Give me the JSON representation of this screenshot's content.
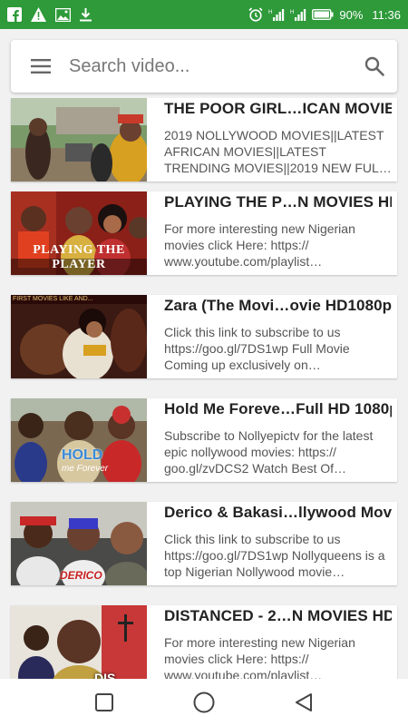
{
  "status_bar": {
    "battery": "90%",
    "time": "11:36",
    "left_icons": [
      "facebook-icon",
      "warning-icon",
      "image-icon",
      "download-icon"
    ],
    "right_icons": [
      "alarm-icon",
      "signal-icon",
      "signal-icon",
      "battery-icon"
    ]
  },
  "search": {
    "placeholder": "Search video..."
  },
  "videos": [
    {
      "title": "THE POOR GIRL…ICAN MOVIES",
      "description": "2019 NOLLYWOOD MOVIES||LATEST AFRICAN MOVIES||LATEST TRENDING MOVIES||2019 NEW FUL…"
    },
    {
      "title": "PLAYING THE P…N MOVIES HD",
      "description": "For more interesting new Nigerian movies click Here: https:// www.youtube.com/playlist…",
      "thumb_caption": "PLAYING THE PLAYER"
    },
    {
      "title": "Zara (The Movi…ovie HD1080p",
      "description": "Click this link to subscribe to us https://goo.gl/7DS1wp Full Movie Coming up exclusively on…",
      "thumb_caption": "FIRST MOVIES LIKE AND..."
    },
    {
      "title": "Hold Me Foreve…Full HD 1080p",
      "description": "Subscribe to Nollyepictv for the latest epic nollywood movies: https:// goo.gl/zvDCS2 Watch Best Of…",
      "thumb_caption_1": "HOLD",
      "thumb_caption_2": "me Forever"
    },
    {
      "title": "Derico & Bakasi…llywood Movie",
      "description": "Click this link to subscribe to us https://goo.gl/7DS1wp Nollyqueens is a top Nigerian Nollywood movie…",
      "thumb_caption": "DERICO"
    },
    {
      "title": "DISTANCED - 2…N MOVIES HD",
      "description": "For more interesting new Nigerian movies click Here: https:// www.youtube.com/playlist…",
      "thumb_caption": "DIS"
    }
  ],
  "colors": {
    "status_bar_bg": "#2e9a3a",
    "card_bg": "#ffffff",
    "page_bg": "#f1f1f1"
  },
  "nav": {
    "icons": [
      "recent-apps-icon",
      "home-icon",
      "back-icon"
    ]
  }
}
